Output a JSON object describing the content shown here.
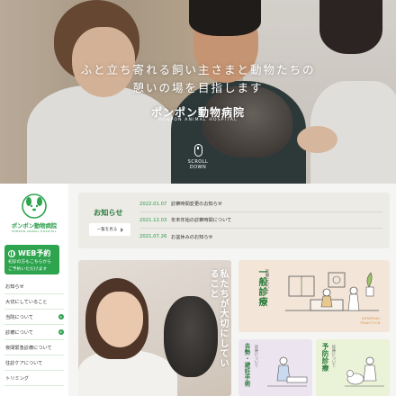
{
  "hero": {
    "tagline_line1": "ふと立ち寄れる飼い主さまと動物たちの",
    "tagline_line2": "憩いの場を目指します",
    "logo_text": "ポンポン動物病院",
    "logo_en": "PONPON ANIMAL HOSPITAL",
    "scroll_label": "SCROLL DOWN"
  },
  "sidebar": {
    "brand_name": "ポンポン動物病院",
    "brand_en": "PONPON ANIMAL HOSPITAL",
    "web_reserve": {
      "title": "WEB予約",
      "sub_line1": "初診の方もこちらから",
      "sub_line2": "ご予約いただけます"
    },
    "nav": [
      {
        "label": "お知らせ",
        "has_arrow": false
      },
      {
        "label": "大切にしていること",
        "has_arrow": false
      },
      {
        "label": "当院について",
        "has_arrow": true
      },
      {
        "label": "診療について",
        "has_arrow": true
      },
      {
        "label": "夜間緊急診療について",
        "has_arrow": false
      },
      {
        "label": "往診ケアについて",
        "has_arrow": false
      },
      {
        "label": "トリミング",
        "has_arrow": false
      }
    ]
  },
  "news": {
    "title": "お知らせ",
    "more_label": "一覧を見る",
    "items": [
      {
        "date": "2022.01.07",
        "text": "診察時間変更のお知らせ"
      },
      {
        "date": "2021.12.03",
        "text": "年末年始の診察時間について"
      },
      {
        "date": "2021.07.26",
        "text": "お盆休みのお知らせ"
      }
    ]
  },
  "cards": {
    "big_title": "私たちが大切にしていること",
    "general": {
      "label": "診療について",
      "title": "一般診療",
      "en_line1": "GENERAL",
      "en_line2": "PRACTICE"
    },
    "surgery": {
      "label": "診療について",
      "title": "去勢・避妊手術"
    },
    "prevention": {
      "label": "診療について",
      "title": "予防診療"
    }
  },
  "colors": {
    "brand_green": "#2ea44f",
    "news_bg": "#ecebe6",
    "general_bg": "#f3e6d8",
    "surgery_bg": "#ece5f0",
    "prevention_bg": "#eaf2d8"
  }
}
